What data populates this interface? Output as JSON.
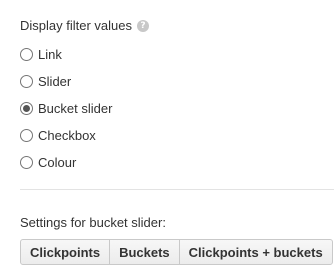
{
  "display_filter": {
    "heading": "Display filter values",
    "help_icon": "help-icon",
    "options": [
      {
        "label": "Link",
        "checked": false
      },
      {
        "label": "Slider",
        "checked": false
      },
      {
        "label": "Bucket slider",
        "checked": true
      },
      {
        "label": "Checkbox",
        "checked": false
      },
      {
        "label": "Colour",
        "checked": false
      }
    ]
  },
  "bucket_settings": {
    "label": "Settings for bucket slider:",
    "buttons": [
      "Clickpoints",
      "Buckets",
      "Clickpoints + buckets"
    ]
  }
}
